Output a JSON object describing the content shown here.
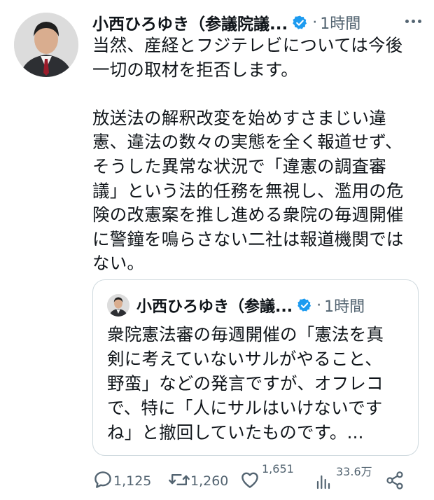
{
  "tweet": {
    "author_name": "小西ひろゆき（参議院議...",
    "time": "1時間",
    "text": "当然、産経とフジテレビについては今後\n一切の取材を拒否します。\n\n放送法の解釈改変を始めすさまじい違\n憲、違法の数々の実態を全く報道せず、\nそうした異常な状況で「違憲の調査審\n議」という法的任務を無視し、濫用の危\n険の改憲案を推し進める衆院の毎週開催\nに警鐘を鳴らさない二社は報道機関では\nない。"
  },
  "quote": {
    "author_name": "小西ひろゆき（参議...",
    "time": "1時間",
    "text": "衆院憲法審の毎週開催の「憲法を真\n剣に考えていないサルがやること、\n野蛮」などの発言ですが、オフレコ\nで、特に「人にサルはいけないです\nね」と撤回していたものです。..."
  },
  "actions": {
    "replies": "1,125",
    "retweets": "1,260",
    "likes": "1,651",
    "views": "33.6万"
  },
  "icons": {
    "verified": "verified-badge-icon",
    "more": "more-options-icon",
    "reply": "reply-icon",
    "retweet": "retweet-icon",
    "like": "like-icon",
    "views": "views-icon",
    "share": "share-icon"
  },
  "colors": {
    "verified": "#1d9bf0",
    "text": "#0f1419",
    "secondary": "#536471",
    "border": "#cfd9de"
  }
}
